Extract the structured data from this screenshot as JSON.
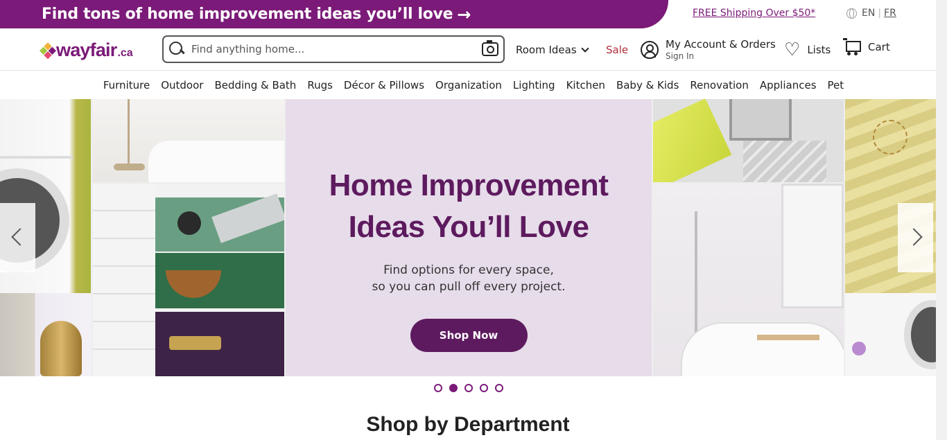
{
  "promo": {
    "text": "Find tons of home improvement ideas you’ll love",
    "arrow": "→"
  },
  "shipping": "FREE Shipping Over $50*",
  "lang": {
    "en": "EN",
    "sep": "|",
    "fr": "FR",
    "icon": "globe-icon"
  },
  "logo": {
    "word": "wayfair",
    "suffix": ".ca"
  },
  "search": {
    "placeholder": "Find anything home...",
    "value": ""
  },
  "header": {
    "room_ideas": "Room Ideas",
    "sale": "Sale",
    "account_title": "My Account & Orders",
    "account_sub": "Sign In",
    "lists": "Lists",
    "cart": "Cart"
  },
  "categories": [
    "Furniture",
    "Outdoor",
    "Bedding & Bath",
    "Rugs",
    "Décor & Pillows",
    "Organization",
    "Lighting",
    "Kitchen",
    "Baby & Kids",
    "Renovation",
    "Appliances",
    "Pet"
  ],
  "hero": {
    "title_line1": "Home Improvement",
    "title_line2": "Ideas You’ll Love",
    "sub_line1": "Find options for every space,",
    "sub_line2": "so you can pull off every project.",
    "button": "Shop Now",
    "active_slide": 2,
    "slide_count": 5
  },
  "section_title": "Shop by Department",
  "colors": {
    "brand": "#7b1a78",
    "dark_purple": "#5d1a5e",
    "sale": "#b02e3a",
    "hero_bg": "#e7dcea"
  }
}
